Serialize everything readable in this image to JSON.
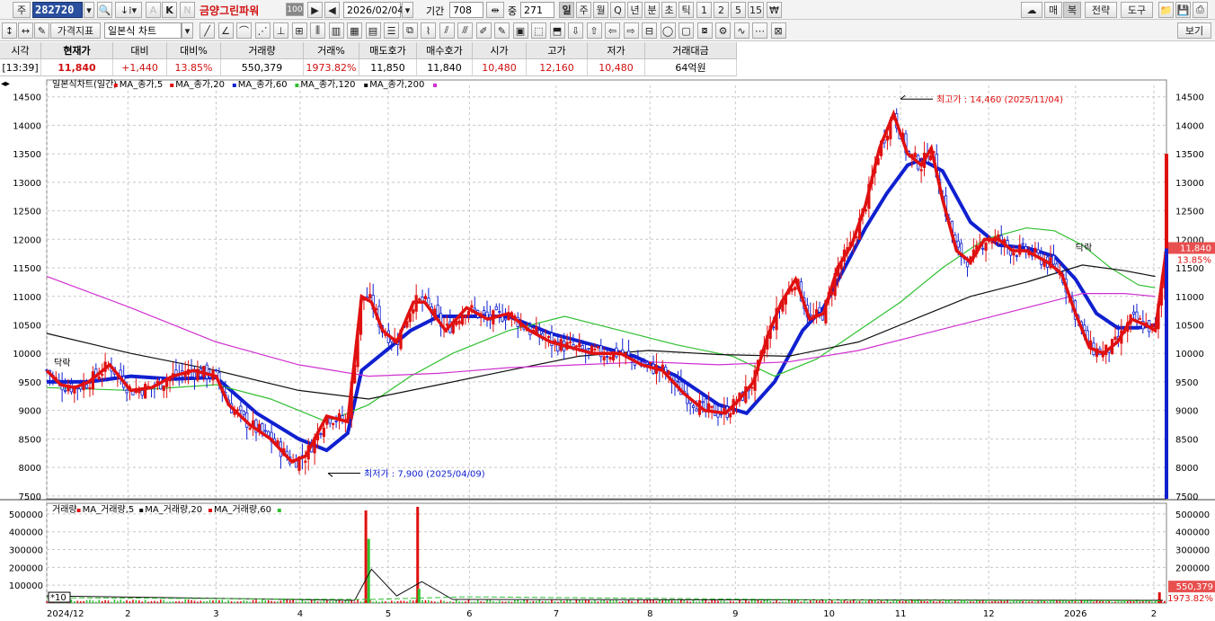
{
  "toolbar1": {
    "stock_prefix": "주",
    "code": "282720",
    "k_label": "K",
    "a_label": "A",
    "n_label": "N",
    "name": "금양그린파워",
    "badge": "100",
    "date": "2026/02/04",
    "period_label": "기간",
    "period_value": "708",
    "overlap_label": "중",
    "overlap_value": "271",
    "periods": [
      "일",
      "주",
      "월",
      "Q",
      "년",
      "분",
      "초",
      "틱",
      "1",
      "2",
      "5",
      "15",
      "₩"
    ],
    "right": [
      "매",
      "복",
      "전략",
      "도구"
    ]
  },
  "toolbar2": {
    "indicator_label": "가격지표",
    "chart_type": "일본식 차트",
    "view_label": "보기"
  },
  "quote": {
    "headers": [
      "시각",
      "현재가",
      "대비",
      "대비%",
      "거래량",
      "거래%",
      "매도호가",
      "매수호가",
      "시가",
      "고가",
      "저가",
      "거래대금"
    ],
    "values": [
      "[13:39]",
      "11,840",
      "+1,440",
      "13.85%",
      "550,379",
      "1973.82%",
      "11,850",
      "11,840",
      "10,480",
      "12,160",
      "10,480",
      "64억원"
    ]
  },
  "legend": {
    "title": "일본식차트(일간)",
    "items": [
      {
        "label": "MA_종가,5",
        "color": "#e01010"
      },
      {
        "label": "MA_종가,20",
        "color": "#e01010"
      },
      {
        "label": "MA_종가,60",
        "color": "#1020d0"
      },
      {
        "label": "MA_종가,120",
        "color": "#30c030"
      },
      {
        "label": "MA_종가,200",
        "color": "#101010"
      }
    ],
    "extra_color": "#d030d0"
  },
  "volume_legend": {
    "title": "거래량",
    "items": [
      {
        "label": "MA_거래량,5",
        "color": "#e01010"
      },
      {
        "label": "MA_거래량,20",
        "color": "#101010"
      },
      {
        "label": "MA_거래량,60",
        "color": "#e01010"
      }
    ],
    "extra_color": "#30c030"
  },
  "annotations": {
    "high": "최고가 : 14,460 (2025/11/04)",
    "low": "최저가 : 7,900 (2025/04/09)",
    "tag1": "닥락",
    "tag2": "닥락",
    "vol_multiplier": "*10"
  },
  "price_badge": {
    "value": "11,840",
    "pct": "13.85%"
  },
  "volume_badge": {
    "value": "550,379",
    "pct": "1973.82%"
  },
  "chart_data": {
    "type": "candlestick",
    "price_axis": [
      "14500",
      "14000",
      "13500",
      "13000",
      "12500",
      "12000",
      "11500",
      "11000",
      "10500",
      "10000",
      "9500",
      "9000",
      "8500",
      "8000",
      "7500"
    ],
    "ylim": [
      7450,
      14700
    ],
    "volume_axis": [
      "500000",
      "400000",
      "300000",
      "200000",
      "100000"
    ],
    "volume_ylim": [
      0,
      560000
    ],
    "x_labels": [
      "2024/12",
      "2",
      "3",
      "4",
      "5",
      "6",
      "7",
      "8",
      "9",
      "10",
      "11",
      "12",
      "2026",
      "2"
    ],
    "x_label_days": [
      0,
      58,
      121,
      181,
      244,
      302,
      364,
      431,
      492,
      559,
      610,
      673,
      735,
      791
    ],
    "total_days": 800,
    "close_path": [
      [
        0,
        9700
      ],
      [
        10,
        9450
      ],
      [
        20,
        9400
      ],
      [
        30,
        9500
      ],
      [
        45,
        9800
      ],
      [
        60,
        9350
      ],
      [
        75,
        9400
      ],
      [
        90,
        9600
      ],
      [
        105,
        9700
      ],
      [
        121,
        9600
      ],
      [
        130,
        9100
      ],
      [
        145,
        8750
      ],
      [
        160,
        8500
      ],
      [
        175,
        8100
      ],
      [
        185,
        8200
      ],
      [
        200,
        8900
      ],
      [
        215,
        8800
      ],
      [
        225,
        11000
      ],
      [
        232,
        10900
      ],
      [
        240,
        10400
      ],
      [
        250,
        10200
      ],
      [
        262,
        10900
      ],
      [
        270,
        10900
      ],
      [
        285,
        10400
      ],
      [
        300,
        10800
      ],
      [
        315,
        10600
      ],
      [
        330,
        10700
      ],
      [
        345,
        10400
      ],
      [
        360,
        10200
      ],
      [
        375,
        10100
      ],
      [
        390,
        10000
      ],
      [
        410,
        10000
      ],
      [
        425,
        9800
      ],
      [
        440,
        9700
      ],
      [
        455,
        9300
      ],
      [
        470,
        9000
      ],
      [
        485,
        8950
      ],
      [
        495,
        9200
      ],
      [
        505,
        9500
      ],
      [
        515,
        10300
      ],
      [
        525,
        10900
      ],
      [
        535,
        11300
      ],
      [
        545,
        10600
      ],
      [
        555,
        10700
      ],
      [
        565,
        11500
      ],
      [
        575,
        11900
      ],
      [
        585,
        12600
      ],
      [
        595,
        13600
      ],
      [
        605,
        14200
      ],
      [
        615,
        13500
      ],
      [
        625,
        13300
      ],
      [
        632,
        13600
      ],
      [
        640,
        12700
      ],
      [
        650,
        11800
      ],
      [
        660,
        11600
      ],
      [
        670,
        12000
      ],
      [
        680,
        12000
      ],
      [
        690,
        11800
      ],
      [
        700,
        11800
      ],
      [
        715,
        11600
      ],
      [
        725,
        11400
      ],
      [
        735,
        10700
      ],
      [
        745,
        10100
      ],
      [
        755,
        10000
      ],
      [
        765,
        10200
      ],
      [
        775,
        10600
      ],
      [
        785,
        10500
      ],
      [
        792,
        10400
      ],
      [
        800,
        11840
      ]
    ],
    "ma_paths": [
      {
        "name": "MA_종가,60",
        "color": "#1020d0",
        "points": [
          [
            0,
            9500
          ],
          [
            30,
            9500
          ],
          [
            60,
            9600
          ],
          [
            90,
            9550
          ],
          [
            121,
            9580
          ],
          [
            150,
            8950
          ],
          [
            180,
            8500
          ],
          [
            200,
            8300
          ],
          [
            215,
            8600
          ],
          [
            225,
            9700
          ],
          [
            240,
            10000
          ],
          [
            260,
            10400
          ],
          [
            280,
            10650
          ],
          [
            300,
            10650
          ],
          [
            330,
            10650
          ],
          [
            360,
            10350
          ],
          [
            390,
            10150
          ],
          [
            420,
            9950
          ],
          [
            450,
            9600
          ],
          [
            480,
            9100
          ],
          [
            500,
            8950
          ],
          [
            520,
            9500
          ],
          [
            540,
            10400
          ],
          [
            555,
            10800
          ],
          [
            570,
            11500
          ],
          [
            585,
            12200
          ],
          [
            600,
            12800
          ],
          [
            615,
            13300
          ],
          [
            625,
            13400
          ],
          [
            640,
            13200
          ],
          [
            660,
            12300
          ],
          [
            680,
            11900
          ],
          [
            700,
            11850
          ],
          [
            720,
            11700
          ],
          [
            735,
            11300
          ],
          [
            750,
            10700
          ],
          [
            765,
            10450
          ],
          [
            780,
            10450
          ],
          [
            792,
            10500
          ]
        ]
      },
      {
        "name": "MA_종가,120",
        "color": "#30c030",
        "points": [
          [
            0,
            9400
          ],
          [
            60,
            9350
          ],
          [
            121,
            9450
          ],
          [
            160,
            9200
          ],
          [
            200,
            8800
          ],
          [
            230,
            9100
          ],
          [
            260,
            9600
          ],
          [
            290,
            10000
          ],
          [
            330,
            10400
          ],
          [
            370,
            10650
          ],
          [
            410,
            10400
          ],
          [
            450,
            10150
          ],
          [
            490,
            9950
          ],
          [
            520,
            9600
          ],
          [
            550,
            9900
          ],
          [
            580,
            10400
          ],
          [
            610,
            10900
          ],
          [
            640,
            11500
          ],
          [
            670,
            12000
          ],
          [
            700,
            12200
          ],
          [
            720,
            12150
          ],
          [
            740,
            11900
          ],
          [
            760,
            11500
          ],
          [
            780,
            11200
          ],
          [
            792,
            11150
          ]
        ]
      },
      {
        "name": "MA_종가,200",
        "color": "#101010",
        "points": [
          [
            0,
            10350
          ],
          [
            60,
            10000
          ],
          [
            121,
            9700
          ],
          [
            180,
            9350
          ],
          [
            230,
            9200
          ],
          [
            280,
            9450
          ],
          [
            330,
            9700
          ],
          [
            380,
            9950
          ],
          [
            430,
            10050
          ],
          [
            480,
            9980
          ],
          [
            530,
            9950
          ],
          [
            580,
            10200
          ],
          [
            620,
            10600
          ],
          [
            660,
            11000
          ],
          [
            700,
            11250
          ],
          [
            740,
            11550
          ],
          [
            770,
            11450
          ],
          [
            792,
            11350
          ]
        ]
      },
      {
        "name": "magenta",
        "color": "#d030d0",
        "points": [
          [
            0,
            11350
          ],
          [
            60,
            10800
          ],
          [
            121,
            10200
          ],
          [
            180,
            9800
          ],
          [
            230,
            9600
          ],
          [
            280,
            9650
          ],
          [
            330,
            9750
          ],
          [
            380,
            9800
          ],
          [
            430,
            9850
          ],
          [
            480,
            9800
          ],
          [
            530,
            9850
          ],
          [
            580,
            10050
          ],
          [
            620,
            10300
          ],
          [
            660,
            10550
          ],
          [
            700,
            10800
          ],
          [
            740,
            11050
          ],
          [
            770,
            11050
          ],
          [
            792,
            11000
          ]
        ]
      }
    ],
    "volume_spikes": [
      [
        228,
        520000,
        "#e01010"
      ],
      [
        230,
        360000,
        "#30c030"
      ],
      [
        265,
        540000,
        "#e01010"
      ],
      [
        266,
        80000,
        "#30c030"
      ],
      [
        795,
        60000,
        "#e01010"
      ]
    ]
  }
}
